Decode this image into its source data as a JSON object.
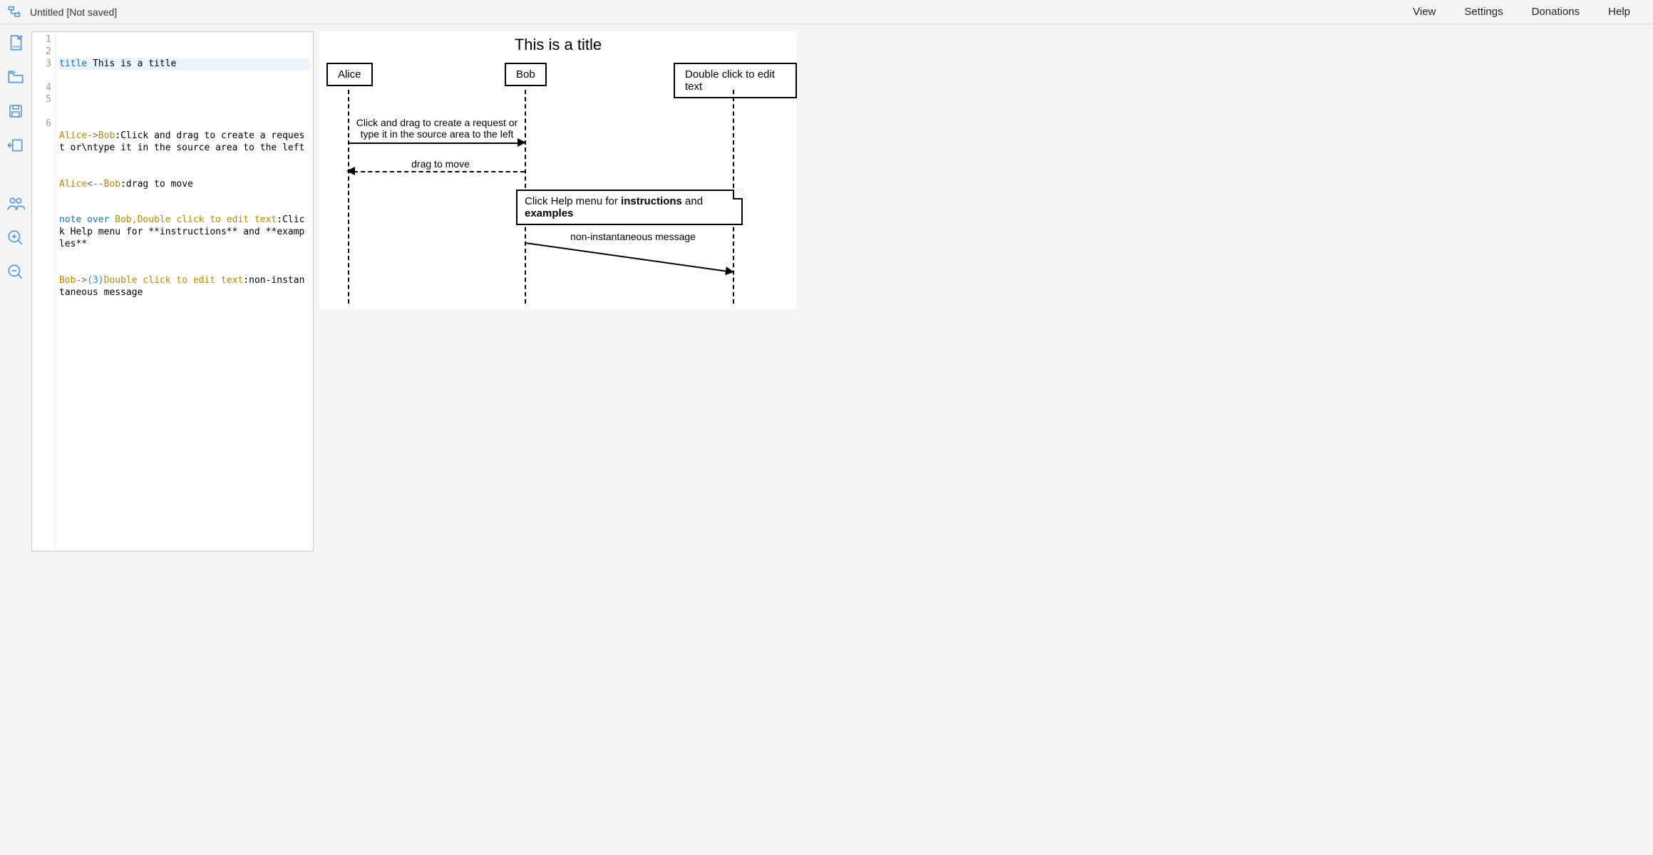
{
  "header": {
    "doc_title": "Untitled [Not saved]",
    "menu": {
      "view": "View",
      "settings": "Settings",
      "donations": "Donations",
      "help": "Help"
    }
  },
  "sidebar_icons": {
    "new": "new-file-icon",
    "open": "open-folder-icon",
    "save": "save-icon",
    "export": "export-icon",
    "participants": "participants-icon",
    "zoom_in": "zoom-in-icon",
    "zoom_out": "zoom-out-icon"
  },
  "editor": {
    "line_numbers": [
      "1",
      "2",
      "3",
      "4",
      "5",
      "6"
    ],
    "lines": {
      "l1_kw": "title",
      "l1_rest": " This is a title",
      "l3_a": "Alice",
      "l3_arrow": "->",
      "l3_b": "Bob",
      "l3_rest": ":Click and drag to create a request or\\ntype it in the source area to the left",
      "l4_a": "Alice",
      "l4_arrow": "<--",
      "l4_b": "Bob",
      "l4_rest": ":drag to move",
      "l5_kw": "note over",
      "l5_targets": " Bob,Double click to edit text",
      "l5_rest": ":Click Help menu for **instructions** and **examples**",
      "l6_a": "Bob",
      "l6_arrow": "->",
      "l6_num": "(3)",
      "l6_b": "Double click to edit text",
      "l6_rest": ":non-instantaneous message"
    }
  },
  "diagram": {
    "title": "This is a title",
    "participants": {
      "alice": "Alice",
      "bob": "Bob",
      "third": "Double click to edit text"
    },
    "messages": {
      "m1_l1": "Click and drag to create a request or",
      "m1_l2": "type it in the source area to the left",
      "m2": "drag to move",
      "note_pre": "Click Help menu for ",
      "note_b1": "instructions",
      "note_mid": " and ",
      "note_b2": "examples",
      "m3": "non-instantaneous message"
    }
  }
}
